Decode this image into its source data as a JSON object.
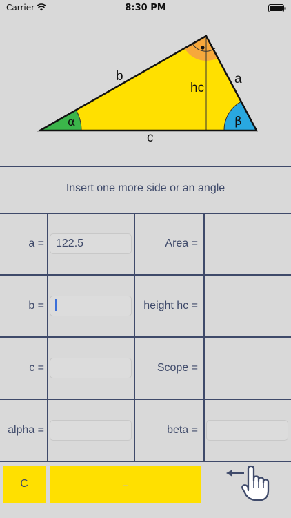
{
  "status_bar": {
    "carrier": "Carrier",
    "time": "8:30 PM"
  },
  "diagram": {
    "side_a": "a",
    "side_b": "b",
    "side_c": "c",
    "height": "hc",
    "alpha_symbol": "α",
    "beta_symbol": "β",
    "colors": {
      "triangle": "#ffe000",
      "alpha_arc": "#3bb54a",
      "beta_arc": "#29a8e0",
      "right_angle": "#f6a83c"
    }
  },
  "hint": "Insert one more side or an angle",
  "rows": {
    "a_label": "a =",
    "a_value": "122.5",
    "area_label": "Area =",
    "b_label": "b =",
    "height_label": "height hc =",
    "c_label": "c =",
    "scope_label": "Scope =",
    "alpha_label": "alpha =",
    "beta_label": "beta ="
  },
  "buttons": {
    "clear": "C",
    "equals": "="
  },
  "icons": {
    "wifi": "wifi-icon",
    "battery": "battery-icon",
    "back": "hand-pointer-backspace-icon"
  }
}
